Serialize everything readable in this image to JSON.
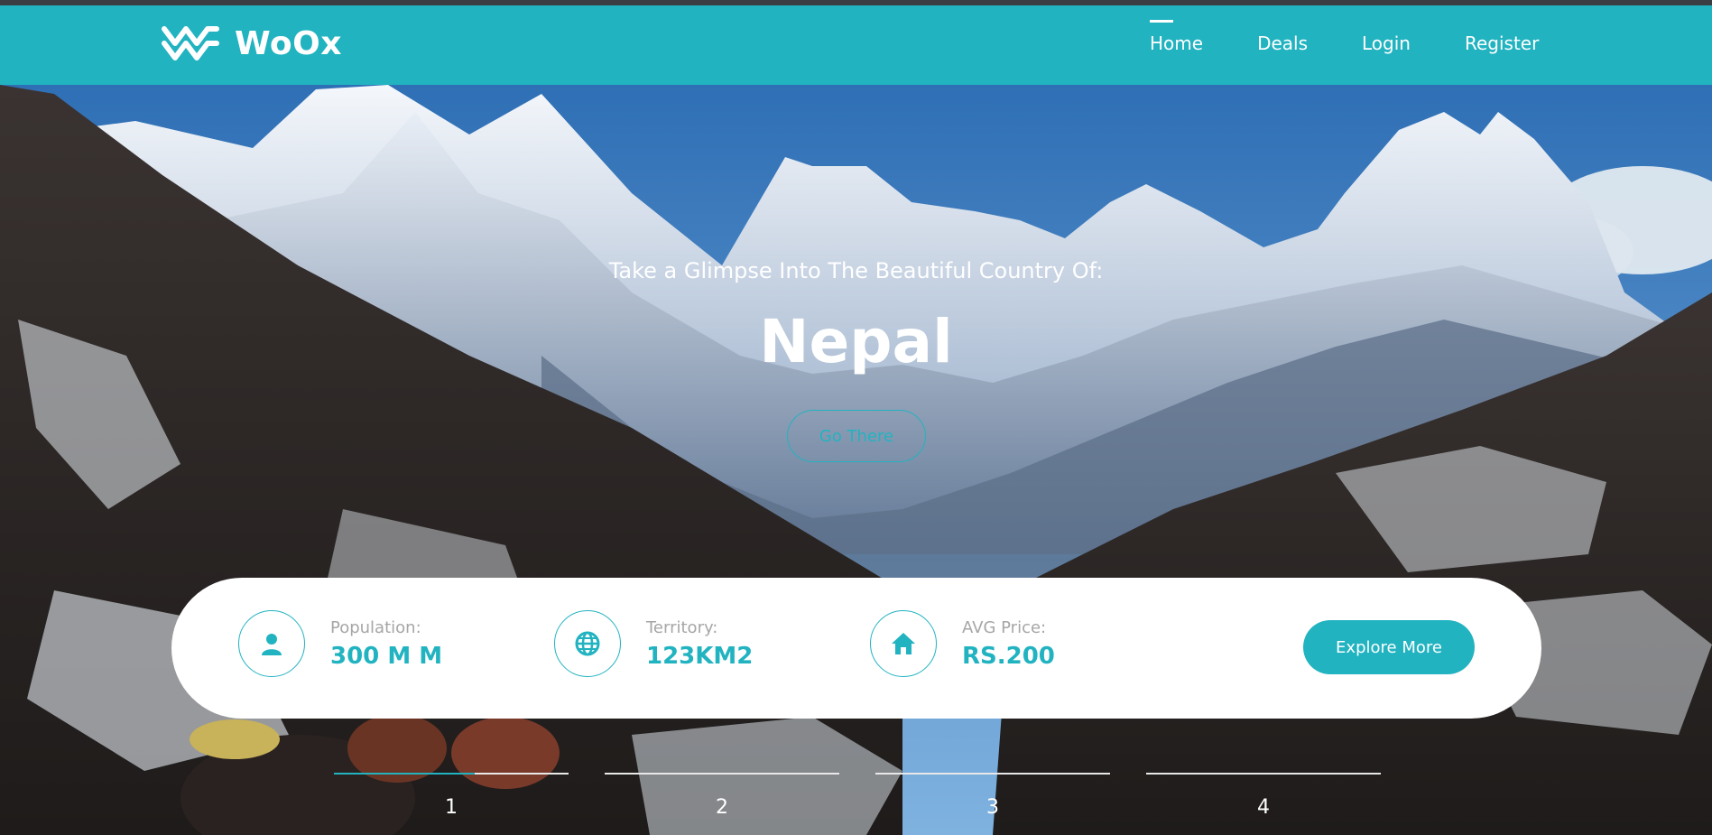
{
  "brand": {
    "name": "WoOx",
    "icon": "woox-logo-icon"
  },
  "nav": {
    "items": [
      {
        "label": "Home",
        "active": true
      },
      {
        "label": "Deals",
        "active": false
      },
      {
        "label": "Login",
        "active": false
      },
      {
        "label": "Register",
        "active": false
      }
    ]
  },
  "hero": {
    "subtitle": "Take a Glimpse Into The Beautiful Country Of:",
    "country": "Nepal",
    "button": "Go There"
  },
  "info": {
    "stats": [
      {
        "label": "Population:",
        "value": "300 M M",
        "icon": "user-icon"
      },
      {
        "label": "Territory:",
        "value": "123KM2",
        "icon": "globe-icon"
      },
      {
        "label": "AVG Price:",
        "value": "RS.200",
        "icon": "home-icon"
      }
    ],
    "button": "Explore More"
  },
  "slider": {
    "items": [
      "1",
      "2",
      "3",
      "4"
    ],
    "active_index": 0
  },
  "colors": {
    "accent": "#22b3c1",
    "white": "#ffffff",
    "label_gray": "#a6a6a6"
  }
}
